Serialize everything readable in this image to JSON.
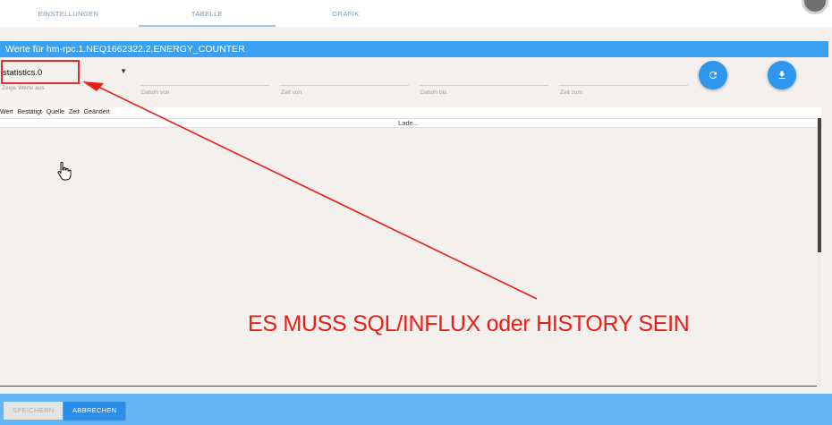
{
  "tabs": [
    {
      "label": "Einstellungen",
      "active": false
    },
    {
      "label": "Tabelle",
      "active": true
    },
    {
      "label": "Grafik",
      "active": false
    }
  ],
  "dialog_title": "Werte für hm-rpc.1.NEQ1662322.2.ENERGY_COUNTER",
  "filters": {
    "instance_select": {
      "value": "statistics.0",
      "label": "Zeige Werte aus"
    },
    "date_from": {
      "label": "Datum von",
      "value": ""
    },
    "time_from": {
      "label": "Zeit von",
      "value": ""
    },
    "date_to": {
      "label": "Datum bis",
      "value": ""
    },
    "time_to": {
      "label": "Zeit zum",
      "value": ""
    },
    "refresh_icon": "refresh-icon",
    "download_icon": "download-icon"
  },
  "table": {
    "columns": [
      "Wert",
      "Bestätigt",
      "Quelle",
      "Zeit",
      "Geändert"
    ],
    "loading_text": "Lade..."
  },
  "annotation": {
    "text": "ES MUSS SQL/INFLUX oder HISTORY SEIN",
    "color": "#ea1d17"
  },
  "footer": {
    "save_label": "Speichern",
    "cancel_label": "Abbrechen"
  },
  "colors": {
    "accent": "#3ba0f0",
    "footer": "#64b5f6",
    "background": "#f3f0ed"
  }
}
